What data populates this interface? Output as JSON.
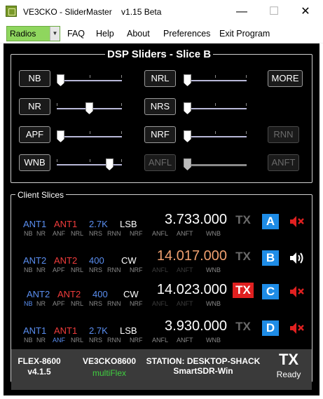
{
  "window": {
    "title": "VE3CKO - SliderMaster    v1.15 Beta",
    "minimize_glyph": "—",
    "maximize_glyph": "☐",
    "close_glyph": "✕"
  },
  "menu": {
    "combo_value": "Radios",
    "combo_arrow": "▼",
    "items": [
      "FAQ",
      "Help",
      "About",
      "Preferences",
      "Exit Program"
    ]
  },
  "dsp": {
    "title": "DSP Sliders - Slice B",
    "left": [
      {
        "label": "NB",
        "level": 0.0
      },
      {
        "label": "NR",
        "level": 0.5
      },
      {
        "label": "APF",
        "level": 0.0
      },
      {
        "label": "WNB",
        "level": 0.85
      }
    ],
    "right": [
      {
        "label": "NRL",
        "level": 0.0,
        "enabled": true
      },
      {
        "label": "NRS",
        "level": 0.0,
        "enabled": true
      },
      {
        "label": "NRF",
        "level": 0.0,
        "enabled": true
      },
      {
        "label": "ANFL",
        "level": 0.0,
        "enabled": false
      }
    ],
    "extra": [
      {
        "label": "MORE",
        "enabled": true
      },
      {
        "label": "RNN",
        "enabled": false
      },
      {
        "label": "ANFT",
        "enabled": false
      }
    ]
  },
  "slices_title": "Client Slices",
  "slices": [
    {
      "ant_rx": "ANT1",
      "ant_tx": "ANT1",
      "bandwidth": "2.7K",
      "mode": "LSB",
      "frequency": "3.733.000",
      "freq_color": "#ffffff",
      "tx": "TX",
      "tx_active": false,
      "letter": "A",
      "muted": true,
      "flags": [
        "NB",
        "NR",
        "ANF",
        "NRL",
        "NRS",
        "RNN",
        "NRF",
        "ANFL",
        "ANFT",
        "WNB"
      ],
      "flags_active": [
        "NB",
        "NR",
        "ANF",
        "NRL",
        "NRS",
        "RNN",
        "NRF",
        "ANFL",
        "ANFT",
        "WNB"
      ],
      "flags_blue": []
    },
    {
      "ant_rx": "ANT2",
      "ant_tx": "ANT2",
      "bandwidth": "400",
      "mode": "CW",
      "frequency": "14.017.000",
      "freq_color": "#f0a070",
      "tx": "TX",
      "tx_active": false,
      "letter": "B",
      "muted": false,
      "flags": [
        "NB",
        "NR",
        "APF",
        "NRL",
        "NRS",
        "RNN",
        "NRF",
        "ANFL",
        "ANFT",
        "WNB"
      ],
      "flags_active": [
        "NB",
        "NR",
        "APF",
        "NRL",
        "NRS",
        "RNN",
        "NRF",
        "WNB"
      ],
      "flags_blue": []
    },
    {
      "ant_rx": "ANT2",
      "ant_tx": "ANT2",
      "bandwidth": "400",
      "mode": "CW",
      "frequency": "14.023.000",
      "freq_color": "#ffffff",
      "tx": "TX",
      "tx_active": true,
      "letter": "C",
      "muted": true,
      "flags": [
        "NB",
        "NR",
        "APF",
        "NRL",
        "NRS",
        "RNN",
        "NRF",
        "ANFL",
        "ANFT",
        "WNB"
      ],
      "flags_active": [
        "NB",
        "NR",
        "APF",
        "NRL",
        "NRS",
        "RNN",
        "NRF",
        "WNB"
      ],
      "flags_blue": [
        "NB"
      ]
    },
    {
      "ant_rx": "ANT1",
      "ant_tx": "ANT1",
      "bandwidth": "2.7K",
      "mode": "LSB",
      "frequency": "3.930.000",
      "freq_color": "#ffffff",
      "tx": "TX",
      "tx_active": false,
      "letter": "D",
      "muted": true,
      "flags": [
        "NB",
        "NR",
        "ANF",
        "NRL",
        "NRS",
        "RNN",
        "NRF",
        "ANFL",
        "ANFT",
        "WNB"
      ],
      "flags_active": [
        "NB",
        "NR",
        "ANF",
        "NRL",
        "NRS",
        "RNN",
        "NRF",
        "ANFL",
        "ANFT",
        "WNB"
      ],
      "flags_blue": [
        "ANF"
      ]
    }
  ],
  "status": {
    "radio_model": "FLEX-8600",
    "version": "v4.1.5",
    "callsign": "VE3CKO8600",
    "multiflex": "multiFlex",
    "station": "STATION: DESKTOP-SHACK",
    "client": "SmartSDR-Win",
    "tx": "TX",
    "tx_state": "Ready"
  },
  "colors": {
    "ant_rx": "#5a8ef0",
    "ant_tx": "#f03c3c",
    "bandwidth": "#5a8ef0",
    "flag_active": "#8a8a8a",
    "flag_inactive": "#3c3c3c",
    "flag_blue": "#5a8ef0",
    "tx_active_bg": "#e02020",
    "multiflex": "#40d040"
  }
}
